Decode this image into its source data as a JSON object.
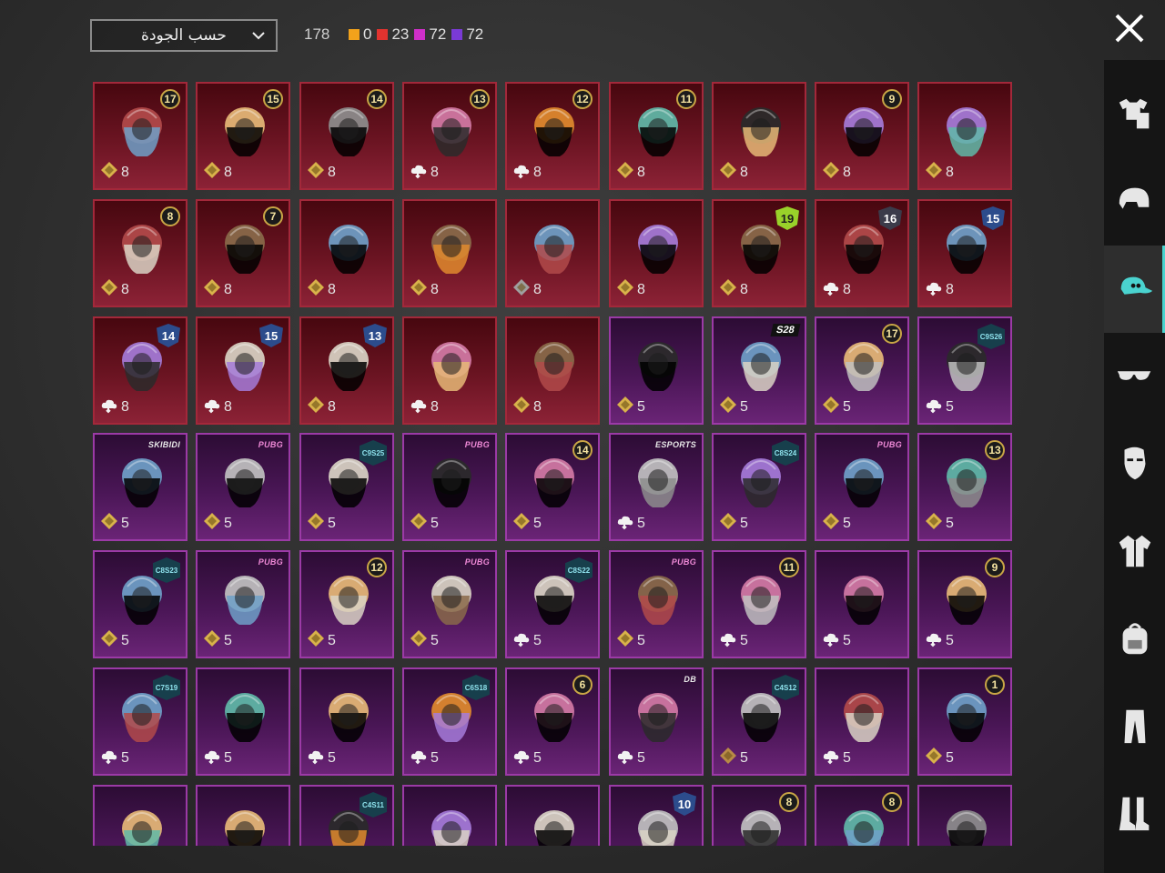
{
  "header": {
    "sort_label": "حسب الجودة",
    "total": "178",
    "counts": [
      {
        "color": "#f2a21b",
        "value": "0"
      },
      {
        "color": "#e2332f",
        "value": "23"
      },
      {
        "color": "#cf2fc9",
        "value": "72"
      },
      {
        "color": "#7a3ad6",
        "value": "72"
      }
    ],
    "close_icon": "close-x-icon"
  },
  "colors": {
    "red_tile": "#8c2236",
    "purple_tile": "#6a2476",
    "accent": "#4ad3cf"
  },
  "items": [
    {
      "rarity": "red",
      "art": "fox-mask",
      "badge": {
        "type": "number",
        "text": "17"
      },
      "cur": "gold",
      "cost": "8"
    },
    {
      "rarity": "red",
      "art": "bow-hair",
      "badge": {
        "type": "number",
        "text": "15"
      },
      "cur": "gold",
      "cost": "8"
    },
    {
      "rarity": "red",
      "art": "cat-mask",
      "badge": {
        "type": "number",
        "text": "14"
      },
      "cur": "gold",
      "cost": "8"
    },
    {
      "rarity": "red",
      "art": "hat-hair",
      "badge": {
        "type": "number",
        "text": "13"
      },
      "cur": "cloud",
      "cost": "8"
    },
    {
      "rarity": "red",
      "art": "curly-hair",
      "badge": {
        "type": "number",
        "text": "12"
      },
      "cur": "cloud",
      "cost": "8"
    },
    {
      "rarity": "red",
      "art": "dark-hair",
      "badge": {
        "type": "number",
        "text": "11"
      },
      "cur": "gold",
      "cost": "8"
    },
    {
      "rarity": "red",
      "art": "goggle-hair",
      "badge": null,
      "cur": "gold",
      "cost": "8"
    },
    {
      "rarity": "red",
      "art": "green-face",
      "badge": {
        "type": "number",
        "text": "9"
      },
      "cur": "gold",
      "cost": "8"
    },
    {
      "rarity": "red",
      "art": "cowboy-hat",
      "badge": null,
      "cur": "gold",
      "cost": "8"
    },
    {
      "rarity": "red",
      "art": "white-hair",
      "badge": {
        "type": "number",
        "text": "8"
      },
      "cur": "gold",
      "cost": "8"
    },
    {
      "rarity": "red",
      "art": "long-white-hair",
      "badge": {
        "type": "number",
        "text": "7"
      },
      "cur": "gold",
      "cost": "8"
    },
    {
      "rarity": "red",
      "art": "red-helmet",
      "badge": null,
      "cur": "gold",
      "cost": "8"
    },
    {
      "rarity": "red",
      "art": "horn-helmet",
      "badge": null,
      "cur": "gold",
      "cost": "8"
    },
    {
      "rarity": "red",
      "art": "blue-hair",
      "badge": null,
      "cur": "silver",
      "cost": "8"
    },
    {
      "rarity": "red",
      "art": "cap-mask",
      "badge": null,
      "cur": "gold",
      "cost": "8"
    },
    {
      "rarity": "red",
      "art": "pink-mask",
      "badge": {
        "type": "shield-green",
        "text": "19"
      },
      "cur": "gold",
      "cost": "8"
    },
    {
      "rarity": "red",
      "art": "purple-helmet",
      "badge": {
        "type": "shield-dark",
        "text": "16"
      },
      "cur": "cloud",
      "cost": "8"
    },
    {
      "rarity": "red",
      "art": "knight-helmet",
      "badge": {
        "type": "shield",
        "text": "15"
      },
      "cur": "cloud",
      "cost": "8"
    },
    {
      "rarity": "red",
      "art": "purple-hair",
      "badge": {
        "type": "shield",
        "text": "14"
      },
      "cur": "cloud",
      "cost": "8"
    },
    {
      "rarity": "red",
      "art": "hood",
      "badge": {
        "type": "shield",
        "text": "15"
      },
      "cur": "cloud",
      "cost": "8"
    },
    {
      "rarity": "red",
      "art": "robot-helmet",
      "badge": {
        "type": "shield",
        "text": "13"
      },
      "cur": "gold",
      "cost": "8"
    },
    {
      "rarity": "red",
      "art": "mummy-mask",
      "badge": null,
      "cur": "cloud",
      "cost": "8"
    },
    {
      "rarity": "red",
      "art": "butterfly",
      "badge": null,
      "cur": "gold",
      "cost": "8"
    },
    {
      "rarity": "purple",
      "art": "red-hair",
      "badge": null,
      "cur": "gold",
      "cost": "5"
    },
    {
      "rarity": "purple",
      "art": "dragon-hat",
      "badge": {
        "type": "season-tag",
        "text": "S28"
      },
      "cur": "gold",
      "cost": "5"
    },
    {
      "rarity": "purple",
      "art": "cap-blonde",
      "badge": {
        "type": "number",
        "text": "17"
      },
      "cur": "gold",
      "cost": "5"
    },
    {
      "rarity": "purple",
      "art": "bug-helmet",
      "badge": {
        "type": "season",
        "text": "C9S26"
      },
      "cur": "cloud",
      "cost": "5"
    },
    {
      "rarity": "purple",
      "art": "camera",
      "badge": {
        "type": "logo",
        "text": "SKIBIDI"
      },
      "cur": "gold",
      "cost": "5"
    },
    {
      "rarity": "purple",
      "art": "bow-headband",
      "badge": {
        "type": "logo-pink",
        "text": "PUBG"
      },
      "cur": "gold",
      "cost": "5"
    },
    {
      "rarity": "purple",
      "art": "grey-hair",
      "badge": {
        "type": "season",
        "text": "C9S25"
      },
      "cur": "gold",
      "cost": "5"
    },
    {
      "rarity": "purple",
      "art": "box-head",
      "badge": {
        "type": "logo-pink",
        "text": "PUBG"
      },
      "cur": "gold",
      "cost": "5"
    },
    {
      "rarity": "purple",
      "art": "flower-hair",
      "badge": {
        "type": "number",
        "text": "14"
      },
      "cur": "gold",
      "cost": "5"
    },
    {
      "rarity": "purple",
      "art": "bucket-hat",
      "badge": {
        "type": "logo",
        "text": "ESPORTS"
      },
      "cur": "cloud",
      "cost": "5"
    },
    {
      "rarity": "purple",
      "art": "short-hair",
      "badge": {
        "type": "season",
        "text": "C8S24"
      },
      "cur": "gold",
      "cost": "5"
    },
    {
      "rarity": "purple",
      "art": "ribbon-hair",
      "badge": {
        "type": "logo-pink",
        "text": "PUBG"
      },
      "cur": "gold",
      "cost": "5"
    },
    {
      "rarity": "purple",
      "art": "goggles-hair",
      "badge": {
        "type": "number",
        "text": "13"
      },
      "cur": "gold",
      "cost": "5"
    },
    {
      "rarity": "purple",
      "art": "headphones",
      "badge": {
        "type": "season",
        "text": "C8S23"
      },
      "cur": "gold",
      "cost": "5"
    },
    {
      "rarity": "purple",
      "art": "visor-cap",
      "badge": {
        "type": "logo-pink",
        "text": "PUBG"
      },
      "cur": "gold",
      "cost": "5"
    },
    {
      "rarity": "purple",
      "art": "orange-hair",
      "badge": {
        "type": "number",
        "text": "12"
      },
      "cur": "gold",
      "cost": "5"
    },
    {
      "rarity": "purple",
      "art": "llama-head",
      "badge": {
        "type": "logo-pink",
        "text": "PUBG"
      },
      "cur": "gold",
      "cost": "5"
    },
    {
      "rarity": "purple",
      "art": "violet-hair",
      "badge": {
        "type": "season",
        "text": "C8S22"
      },
      "cur": "cloud",
      "cost": "5"
    },
    {
      "rarity": "purple",
      "art": "panda-head",
      "badge": {
        "type": "logo-pink",
        "text": "PUBG"
      },
      "cur": "gold",
      "cost": "5"
    },
    {
      "rarity": "purple",
      "art": "veil-hat",
      "badge": {
        "type": "number",
        "text": "11"
      },
      "cur": "cloud",
      "cost": "5"
    },
    {
      "rarity": "purple",
      "art": "pumpkin",
      "badge": null,
      "cur": "cloud",
      "cost": "5"
    },
    {
      "rarity": "purple",
      "art": "brown-hair",
      "badge": {
        "type": "number",
        "text": "9"
      },
      "cur": "cloud",
      "cost": "5"
    },
    {
      "rarity": "purple",
      "art": "dread-hair",
      "badge": {
        "type": "season",
        "text": "C7S19"
      },
      "cur": "cloud",
      "cost": "5"
    },
    {
      "rarity": "purple",
      "art": "gold-mask",
      "badge": null,
      "cur": "cloud",
      "cost": "5"
    },
    {
      "rarity": "purple",
      "art": "wolf-hair",
      "badge": null,
      "cur": "cloud",
      "cost": "5"
    },
    {
      "rarity": "purple",
      "art": "bob-hair",
      "badge": {
        "type": "season",
        "text": "C6S18"
      },
      "cur": "cloud",
      "cost": "5"
    },
    {
      "rarity": "purple",
      "art": "warrior-helmet",
      "badge": {
        "type": "number",
        "text": "6"
      },
      "cur": "cloud",
      "cost": "5"
    },
    {
      "rarity": "purple",
      "art": "purple-helmet2",
      "badge": {
        "type": "logo",
        "text": "DB"
      },
      "cur": "cloud",
      "cost": "5"
    },
    {
      "rarity": "purple",
      "art": "pink-band",
      "badge": {
        "type": "season",
        "text": "C4S12"
      },
      "cur": "bronze",
      "cost": "5"
    },
    {
      "rarity": "purple",
      "art": "potato-head",
      "badge": null,
      "cur": "cloud",
      "cost": "5"
    },
    {
      "rarity": "purple",
      "art": "pigtail-hair",
      "badge": {
        "type": "number",
        "text": "1"
      },
      "cur": "gold",
      "cost": "5"
    },
    {
      "rarity": "purple",
      "art": "spike-hair",
      "badge": null,
      "cur": null,
      "cost": ""
    },
    {
      "rarity": "purple",
      "art": "horn-hat",
      "badge": null,
      "cur": null,
      "cost": ""
    },
    {
      "rarity": "purple",
      "art": "red-cap",
      "badge": {
        "type": "season",
        "text": "C4S11"
      },
      "cur": null,
      "cost": ""
    },
    {
      "rarity": "purple",
      "art": "antenna",
      "badge": null,
      "cur": null,
      "cost": ""
    },
    {
      "rarity": "purple",
      "art": "red-cap2",
      "badge": null,
      "cur": null,
      "cost": ""
    },
    {
      "rarity": "purple",
      "art": "pink-helmet",
      "badge": {
        "type": "shield",
        "text": "10"
      },
      "cur": null,
      "cost": ""
    },
    {
      "rarity": "purple",
      "art": "bucket-helmet",
      "badge": {
        "type": "number",
        "text": "8"
      },
      "cur": null,
      "cost": ""
    },
    {
      "rarity": "purple",
      "art": "grey-hat",
      "badge": {
        "type": "number",
        "text": "8"
      },
      "cur": null,
      "cost": ""
    },
    {
      "rarity": "purple",
      "art": "white-fluff",
      "badge": null,
      "cur": null,
      "cost": ""
    }
  ],
  "sidebar": [
    {
      "icon": "outfit-icon",
      "active": false
    },
    {
      "icon": "helmet-icon",
      "active": false
    },
    {
      "icon": "cap-icon",
      "active": true
    },
    {
      "icon": "glasses-icon",
      "active": false
    },
    {
      "icon": "mask-icon",
      "active": false
    },
    {
      "icon": "jacket-icon",
      "active": false
    },
    {
      "icon": "backpack-icon",
      "active": false
    },
    {
      "icon": "pants-icon",
      "active": false
    },
    {
      "icon": "boots-icon",
      "active": false
    }
  ]
}
